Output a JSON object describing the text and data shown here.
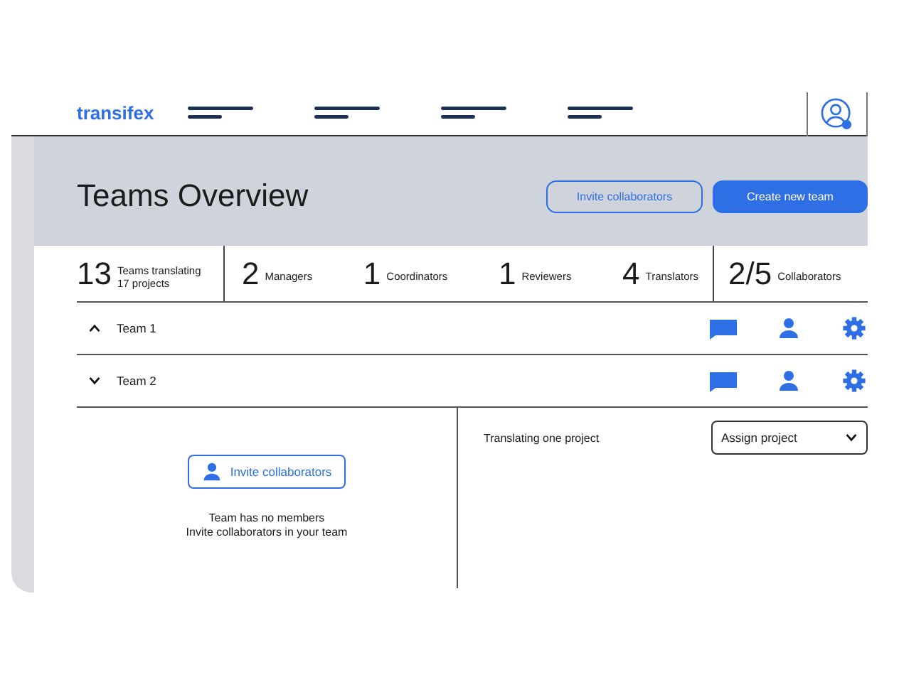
{
  "header": {
    "logo": "transifex"
  },
  "page": {
    "title": "Teams Overview",
    "buttons": [
      {
        "label": "Invite collaborators",
        "kind": "outline"
      },
      {
        "label": "Create new team",
        "kind": "primary"
      }
    ]
  },
  "stat_groups": [
    {
      "stats": [
        {
          "value": "13",
          "label_lines": [
            "Teams translating",
            "17 projects"
          ]
        }
      ]
    },
    {
      "stats": [
        {
          "value": "2",
          "label_lines": [
            "Managers"
          ]
        },
        {
          "value": "1",
          "label_lines": [
            "Coordinators"
          ]
        },
        {
          "value": "1",
          "label_lines": [
            "Reviewers"
          ]
        },
        {
          "value": "4",
          "label_lines": [
            "Translators"
          ]
        }
      ]
    },
    {
      "stats": [
        {
          "value": "2/5",
          "label_lines": [
            "Collaborators"
          ]
        }
      ]
    }
  ],
  "teams": [
    {
      "name": "Team 1",
      "expanded": true
    },
    {
      "name": "Team 2",
      "expanded": false
    }
  ],
  "team_detail": {
    "invite_button": "Invite collaborators",
    "empty_lines": [
      "Team has no members",
      "Invite collaborators in your team"
    ],
    "projects_label": "Translating one project",
    "assign_select": "Assign project"
  }
}
